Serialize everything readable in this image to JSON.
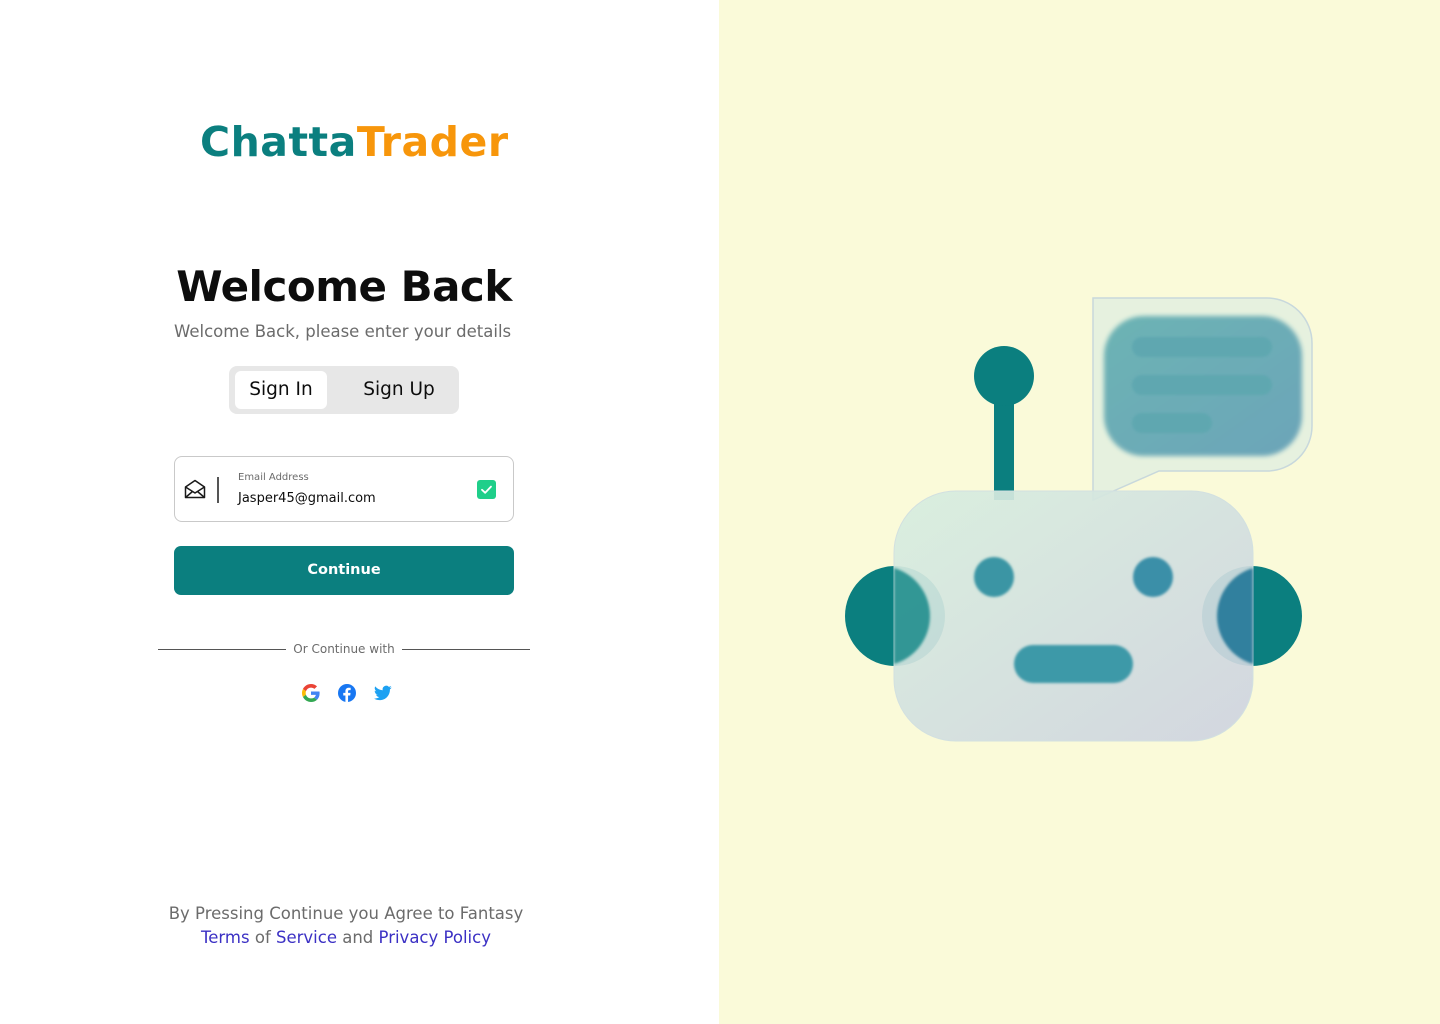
{
  "brand": {
    "name_part1": "Chatta",
    "name_part2": "Trader",
    "primary_color": "#0b7f7f",
    "accent_color": "#f7960b"
  },
  "heading": {
    "title": "Welcome Back",
    "subtitle": "Welcome Back, please enter your details"
  },
  "tabs": [
    {
      "label": "Sign In",
      "active": true
    },
    {
      "label": "Sign Up",
      "active": false
    }
  ],
  "email_field": {
    "label": "Email Address",
    "value": "Jasper45@gmail.com",
    "icon": "envelope-open-icon",
    "status_icon": "check-icon",
    "valid": true
  },
  "continue_button": {
    "label": "Continue"
  },
  "divider_text": "Or Continue with",
  "social_logins": [
    "google-icon",
    "facebook-icon",
    "twitter-icon"
  ],
  "terms": {
    "line1": "By Pressing Continue you Agree to Fantasy",
    "link1": "Terms",
    "word_of": "of",
    "link2": "Service",
    "word_and": "and",
    "link3": "Privacy Policy"
  },
  "illustration": {
    "subject": "robot-chatbot-illustration",
    "background_color": "#fafad9"
  }
}
